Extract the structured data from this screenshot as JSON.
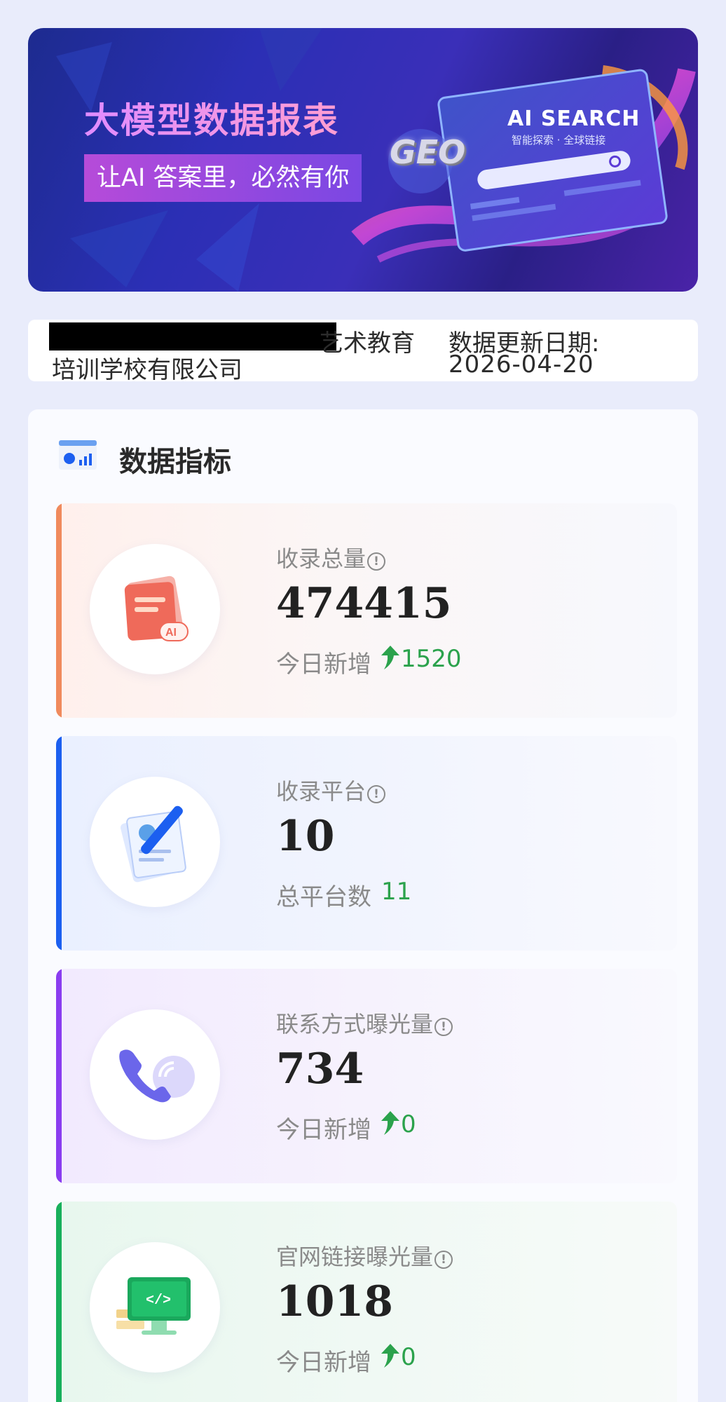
{
  "banner": {
    "title": "大模型数据报表",
    "subtitle": "让AI 答案里，必然有你",
    "geo_label": "GEO",
    "search_title": "AI SEARCH",
    "search_subtitle": "智能探索 · 全球链接"
  },
  "info": {
    "company_line1": "艺术教育",
    "company_line2": "培训学校有限公司",
    "date_label": "数据更新日期:",
    "date_value": "2026-04-20"
  },
  "section": {
    "title": "数据指标"
  },
  "metrics": [
    {
      "label": "收录总量",
      "value": "474415",
      "sub_label": "今日新增",
      "sub_value": "1520",
      "accent": "#f08a5d",
      "icon": "document-ai-icon"
    },
    {
      "label": "收录平台",
      "value": "10",
      "sub_label": "总平台数",
      "sub_value": "11",
      "accent": "#1c5ff0",
      "icon": "notepad-pen-icon"
    },
    {
      "label": "联系方式曝光量",
      "value": "734",
      "sub_label": "今日新增",
      "sub_value": "0",
      "accent": "#8a3df0",
      "icon": "phone-icon"
    },
    {
      "label": "官网链接曝光量",
      "value": "1018",
      "sub_label": "今日新增",
      "sub_value": "0",
      "accent": "#18b05c",
      "icon": "monitor-code-icon"
    }
  ],
  "colors": {
    "background": "#e9ecfb",
    "delta_green": "#2ba24c"
  }
}
